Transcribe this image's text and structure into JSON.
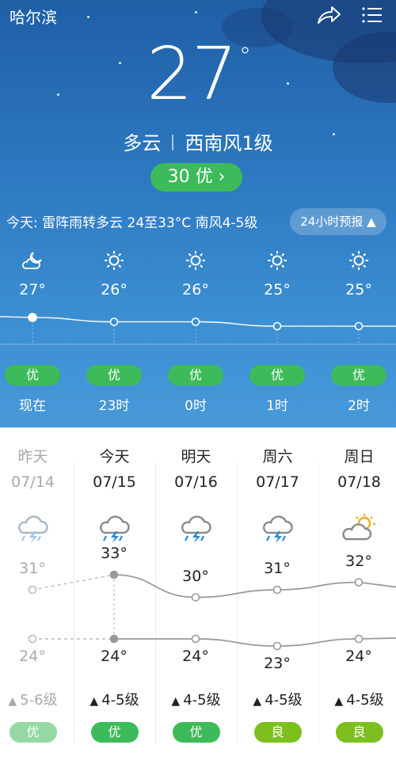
{
  "header": {
    "city": "哈尔滨",
    "share_icon": "share-icon",
    "menu_icon": "menu-icon"
  },
  "current": {
    "temperature": "27",
    "degree": "°",
    "condition": "多云",
    "wind": "西南风1级",
    "aqi_label": "30 优 ›"
  },
  "today": {
    "summary": "今天: 雷阵雨转多云 24至33°C 南风4-5级",
    "forecast_button": "24小时预报 ▲"
  },
  "hourly": [
    {
      "icon": "partly-cloudy-night-icon",
      "temp": "27°",
      "value": 27,
      "aqi": "优",
      "time": "现在"
    },
    {
      "icon": "sun-icon",
      "temp": "26°",
      "value": 26,
      "aqi": "优",
      "time": "23时"
    },
    {
      "icon": "sun-icon",
      "temp": "26°",
      "value": 26,
      "aqi": "优",
      "time": "0时"
    },
    {
      "icon": "sun-icon",
      "temp": "25°",
      "value": 25,
      "aqi": "优",
      "time": "1时"
    },
    {
      "icon": "sun-icon",
      "temp": "25°",
      "value": 25,
      "aqi": "优",
      "time": "2时"
    }
  ],
  "daily": [
    {
      "day": "昨天",
      "date": "07/14",
      "icon": "thunderstorm-icon",
      "high": "31°",
      "low": "24°",
      "high_value": 31,
      "low_value": 24,
      "wind": "5-6级",
      "aqi": "优",
      "aqi_color": "#3dbb5a",
      "past": true
    },
    {
      "day": "今天",
      "date": "07/15",
      "icon": "thunderstorm-icon",
      "high": "33°",
      "low": "24°",
      "high_value": 33,
      "low_value": 24,
      "wind": "4-5级",
      "aqi": "优",
      "aqi_color": "#3dbb5a",
      "past": false
    },
    {
      "day": "明天",
      "date": "07/16",
      "icon": "thunderstorm-icon",
      "high": "30°",
      "low": "24°",
      "high_value": 30,
      "low_value": 24,
      "wind": "4-5级",
      "aqi": "优",
      "aqi_color": "#3dbb5a",
      "past": false
    },
    {
      "day": "周六",
      "date": "07/17",
      "icon": "thunderstorm-icon",
      "high": "31°",
      "low": "23°",
      "high_value": 31,
      "low_value": 23,
      "wind": "4-5级",
      "aqi": "良",
      "aqi_color": "#7cbf1f",
      "past": false
    },
    {
      "day": "周日",
      "date": "07/18",
      "icon": "partly-cloudy-day-icon",
      "high": "32°",
      "low": "24°",
      "high_value": 32,
      "low_value": 24,
      "wind": "4-5级",
      "aqi": "良",
      "aqi_color": "#7cbf1f",
      "past": false
    }
  ],
  "colors": {
    "sky_top": "#1f5fa6",
    "sky_bottom": "#4799d9",
    "aqi_good": "#3dbb5a",
    "aqi_moderate": "#7cbf1f",
    "storm_blue": "#2a88d8",
    "sun_orange": "#f4a623"
  }
}
